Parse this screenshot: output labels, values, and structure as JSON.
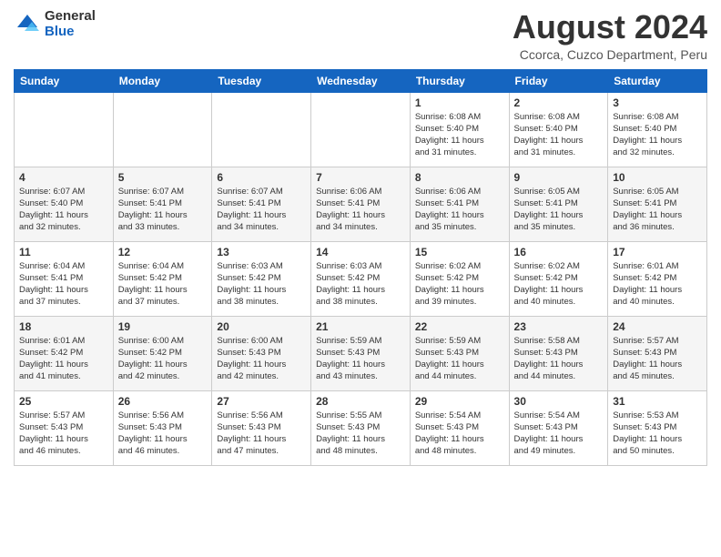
{
  "logo": {
    "general": "General",
    "blue": "Blue"
  },
  "header": {
    "month_year": "August 2024",
    "location": "Ccorca, Cuzco Department, Peru"
  },
  "days_of_week": [
    "Sunday",
    "Monday",
    "Tuesday",
    "Wednesday",
    "Thursday",
    "Friday",
    "Saturday"
  ],
  "weeks": [
    [
      {
        "day": "",
        "info": ""
      },
      {
        "day": "",
        "info": ""
      },
      {
        "day": "",
        "info": ""
      },
      {
        "day": "",
        "info": ""
      },
      {
        "day": "1",
        "info": "Sunrise: 6:08 AM\nSunset: 5:40 PM\nDaylight: 11 hours\nand 31 minutes."
      },
      {
        "day": "2",
        "info": "Sunrise: 6:08 AM\nSunset: 5:40 PM\nDaylight: 11 hours\nand 31 minutes."
      },
      {
        "day": "3",
        "info": "Sunrise: 6:08 AM\nSunset: 5:40 PM\nDaylight: 11 hours\nand 32 minutes."
      }
    ],
    [
      {
        "day": "4",
        "info": "Sunrise: 6:07 AM\nSunset: 5:40 PM\nDaylight: 11 hours\nand 32 minutes."
      },
      {
        "day": "5",
        "info": "Sunrise: 6:07 AM\nSunset: 5:41 PM\nDaylight: 11 hours\nand 33 minutes."
      },
      {
        "day": "6",
        "info": "Sunrise: 6:07 AM\nSunset: 5:41 PM\nDaylight: 11 hours\nand 34 minutes."
      },
      {
        "day": "7",
        "info": "Sunrise: 6:06 AM\nSunset: 5:41 PM\nDaylight: 11 hours\nand 34 minutes."
      },
      {
        "day": "8",
        "info": "Sunrise: 6:06 AM\nSunset: 5:41 PM\nDaylight: 11 hours\nand 35 minutes."
      },
      {
        "day": "9",
        "info": "Sunrise: 6:05 AM\nSunset: 5:41 PM\nDaylight: 11 hours\nand 35 minutes."
      },
      {
        "day": "10",
        "info": "Sunrise: 6:05 AM\nSunset: 5:41 PM\nDaylight: 11 hours\nand 36 minutes."
      }
    ],
    [
      {
        "day": "11",
        "info": "Sunrise: 6:04 AM\nSunset: 5:41 PM\nDaylight: 11 hours\nand 37 minutes."
      },
      {
        "day": "12",
        "info": "Sunrise: 6:04 AM\nSunset: 5:42 PM\nDaylight: 11 hours\nand 37 minutes."
      },
      {
        "day": "13",
        "info": "Sunrise: 6:03 AM\nSunset: 5:42 PM\nDaylight: 11 hours\nand 38 minutes."
      },
      {
        "day": "14",
        "info": "Sunrise: 6:03 AM\nSunset: 5:42 PM\nDaylight: 11 hours\nand 38 minutes."
      },
      {
        "day": "15",
        "info": "Sunrise: 6:02 AM\nSunset: 5:42 PM\nDaylight: 11 hours\nand 39 minutes."
      },
      {
        "day": "16",
        "info": "Sunrise: 6:02 AM\nSunset: 5:42 PM\nDaylight: 11 hours\nand 40 minutes."
      },
      {
        "day": "17",
        "info": "Sunrise: 6:01 AM\nSunset: 5:42 PM\nDaylight: 11 hours\nand 40 minutes."
      }
    ],
    [
      {
        "day": "18",
        "info": "Sunrise: 6:01 AM\nSunset: 5:42 PM\nDaylight: 11 hours\nand 41 minutes."
      },
      {
        "day": "19",
        "info": "Sunrise: 6:00 AM\nSunset: 5:42 PM\nDaylight: 11 hours\nand 42 minutes."
      },
      {
        "day": "20",
        "info": "Sunrise: 6:00 AM\nSunset: 5:43 PM\nDaylight: 11 hours\nand 42 minutes."
      },
      {
        "day": "21",
        "info": "Sunrise: 5:59 AM\nSunset: 5:43 PM\nDaylight: 11 hours\nand 43 minutes."
      },
      {
        "day": "22",
        "info": "Sunrise: 5:59 AM\nSunset: 5:43 PM\nDaylight: 11 hours\nand 44 minutes."
      },
      {
        "day": "23",
        "info": "Sunrise: 5:58 AM\nSunset: 5:43 PM\nDaylight: 11 hours\nand 44 minutes."
      },
      {
        "day": "24",
        "info": "Sunrise: 5:57 AM\nSunset: 5:43 PM\nDaylight: 11 hours\nand 45 minutes."
      }
    ],
    [
      {
        "day": "25",
        "info": "Sunrise: 5:57 AM\nSunset: 5:43 PM\nDaylight: 11 hours\nand 46 minutes."
      },
      {
        "day": "26",
        "info": "Sunrise: 5:56 AM\nSunset: 5:43 PM\nDaylight: 11 hours\nand 46 minutes."
      },
      {
        "day": "27",
        "info": "Sunrise: 5:56 AM\nSunset: 5:43 PM\nDaylight: 11 hours\nand 47 minutes."
      },
      {
        "day": "28",
        "info": "Sunrise: 5:55 AM\nSunset: 5:43 PM\nDaylight: 11 hours\nand 48 minutes."
      },
      {
        "day": "29",
        "info": "Sunrise: 5:54 AM\nSunset: 5:43 PM\nDaylight: 11 hours\nand 48 minutes."
      },
      {
        "day": "30",
        "info": "Sunrise: 5:54 AM\nSunset: 5:43 PM\nDaylight: 11 hours\nand 49 minutes."
      },
      {
        "day": "31",
        "info": "Sunrise: 5:53 AM\nSunset: 5:43 PM\nDaylight: 11 hours\nand 50 minutes."
      }
    ]
  ]
}
